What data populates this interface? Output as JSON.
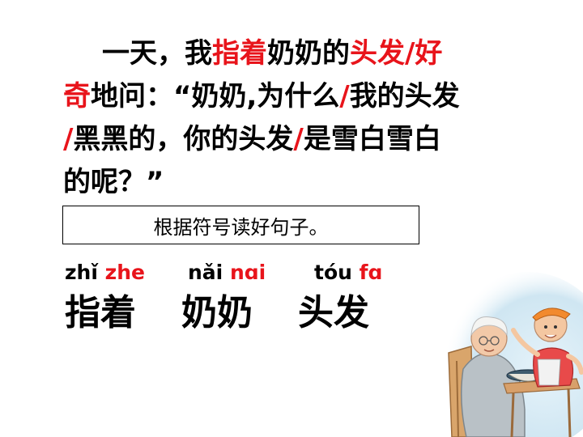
{
  "passage": {
    "line1": [
      "一天，我",
      "指着",
      "奶奶的",
      "头发",
      "/",
      "好"
    ],
    "line2": [
      "奇",
      "地问：“奶奶,为什么",
      "/",
      "我的头发"
    ],
    "line3": [
      "/",
      "黑黑的，你的头发",
      "/",
      "是雪白雪白"
    ],
    "line4": "的呢？”"
  },
  "hint": "根据符号读好句子。",
  "vocab": [
    {
      "pinyin_black": "zhǐ",
      "pinyin_red": "zhe",
      "hanzi": "指着"
    },
    {
      "pinyin_black": "nǎi",
      "pinyin_red": "nɑi",
      "hanzi": "奶奶"
    },
    {
      "pinyin_black": "tóu",
      "pinyin_red": "fɑ",
      "hanzi": "头发"
    }
  ],
  "colors": {
    "accent_red": "#e8141b",
    "text": "#000000"
  }
}
